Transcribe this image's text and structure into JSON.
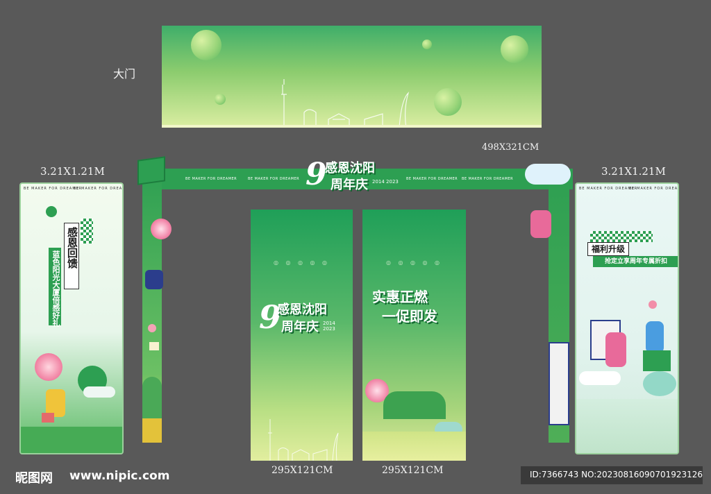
{
  "labels": {
    "door": "大门",
    "arch_size": "498X321CM",
    "left_standee_size": "3.21X1.21M",
    "right_standee_size": "3.21X1.21M",
    "panel1_size": "295X121CM",
    "panel2_size": "295X121CM"
  },
  "arch": {
    "strip_text": "BE MAKER FOR DREAMER",
    "title_number": "9",
    "title_line1": "感恩沈阳",
    "title_line2": "周年庆",
    "years": "2014 2023"
  },
  "panel1": {
    "title_number": "9",
    "title_line1": "感恩沈阳",
    "title_line2": "周年庆",
    "years": "2014 2023",
    "icons": "◎ ◎ ◎ ◎ ◎"
  },
  "panel2": {
    "title_line1": "实惠正燃",
    "title_line2": "一促即发",
    "icons": "◎ ◎ ◎ ◎ ◎"
  },
  "left_standee": {
    "title": "感恩回馈",
    "subtitle": "蓝色阳光大厦倍感好礼",
    "frame_text": "BE MAKER FOR DREAMER"
  },
  "right_standee": {
    "title": "福利升级",
    "subtitle": "抢定立享周年专属折扣",
    "frame_text": "BE MAKER FOR DREAMER"
  },
  "footer": {
    "logo": "昵图网",
    "url": "www.nipic.com",
    "id": "ID:7366743 NO:20230816090701923126"
  },
  "colors": {
    "background": "#595959",
    "brand_green": "#2d9f52",
    "light_green": "#dbeea2"
  }
}
